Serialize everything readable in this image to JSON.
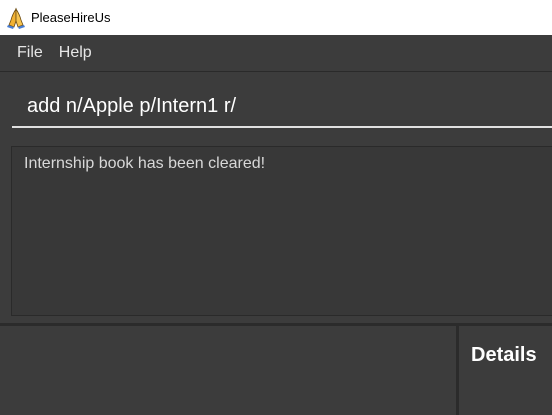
{
  "window": {
    "title": "PleaseHireUs",
    "icon": "praying-hands-icon"
  },
  "menu": {
    "items": [
      "File",
      "Help"
    ]
  },
  "command_box": {
    "value": "add n/Apple p/Intern1 r/"
  },
  "result_display": {
    "message": "Internship book has been cleared!"
  },
  "details_panel": {
    "title": "Details"
  }
}
